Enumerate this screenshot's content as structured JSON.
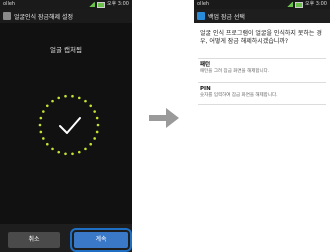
{
  "left_screen": {
    "status": {
      "carrier": "olleh",
      "time": "오후 3:00"
    },
    "title": "얼굴인식 잠금해제 설정",
    "capture_label": "얼굴 캡처됨",
    "buttons": {
      "cancel": "취소",
      "continue": "계속"
    }
  },
  "right_screen": {
    "status": {
      "carrier": "olleh",
      "time": "오후 3:00"
    },
    "title": "백업 잠금 선택",
    "prompt": "얼굴 인식 프로그램이 얼굴을 인식하지 못하는 경우, 어떻게 잠금 해제하시겠습니까?",
    "options": [
      {
        "title": "패턴",
        "desc": "패턴을 그려 잠금 화면을 해제합니다."
      },
      {
        "title": "PIN",
        "desc": "숫자를 입력하여 잠금 화면을 해제합니다."
      }
    ]
  },
  "colors": {
    "ring_dots": "#c6e233",
    "accent": "#1f6fc4"
  }
}
